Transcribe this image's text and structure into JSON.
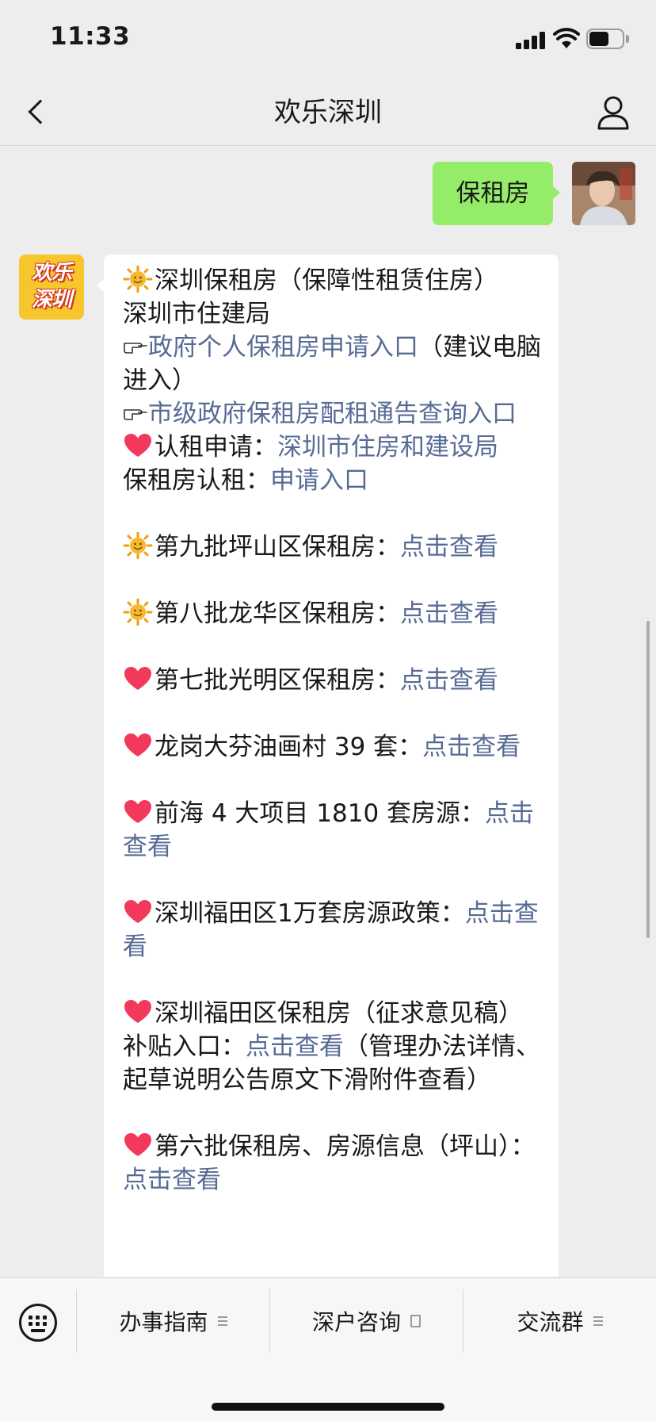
{
  "status_bar": {
    "time": "11:33",
    "battery_level": 0.6
  },
  "nav": {
    "title": "欢乐深圳",
    "back_icon": "chevron-left-icon",
    "profile_icon": "person-icon"
  },
  "chat": {
    "user_message": "保租房",
    "bot_avatar_text": [
      "欢乐",
      "深圳"
    ],
    "bot_message": {
      "title_line": "深圳保租房（保障性租赁住房）",
      "bureau": "深圳市住建局",
      "entry1_link": "政府个人保租房申请入口",
      "entry1_note": "（建议电脑进入）",
      "entry2_link": "市级政府保租房配租通告查询入口",
      "apply_label": "认租申请：",
      "apply_link": "深圳市住房和建设局",
      "rent_label": "保租房认租：",
      "rent_link": "申请入口",
      "items": [
        {
          "icon": "sun",
          "text": "第九批坪山区保租房：",
          "link": "点击查看"
        },
        {
          "icon": "sun",
          "text": "第八批龙华区保租房：",
          "link": "点击查看"
        },
        {
          "icon": "heart",
          "text": "第七批光明区保租房：",
          "link": "点击查看"
        },
        {
          "icon": "heart",
          "text": "龙岗大芬油画村 39 套：",
          "link": "点击查看"
        },
        {
          "icon": "heart",
          "text": "前海 4 大项目 1810 套房源：",
          "link": "点击查看"
        },
        {
          "icon": "heart",
          "text": "深圳福田区1万套房源政策：",
          "link": "点击查看"
        }
      ],
      "futian_prefix": "深圳福田区保租房（征求意见稿）补贴入口：",
      "futian_link": "点击查看",
      "futian_suffix": "（管理办法详情、起草说明公告原文下滑附件查看）",
      "last_text": "第六批保租房、房源信息（坪山）：",
      "last_link": "点击查看"
    }
  },
  "menu": {
    "keyboard_icon": "keyboard-icon",
    "tabs": [
      {
        "label": "办事指南",
        "icon": "menu-list-icon"
      },
      {
        "label": "深户咨询",
        "icon": "document-icon"
      },
      {
        "label": "交流群",
        "icon": "menu-list-icon"
      }
    ]
  },
  "colors": {
    "background": "#ededed",
    "my_bubble": "#95ec69",
    "link": "#576b95",
    "avatar_bg": "#f7c52c"
  }
}
